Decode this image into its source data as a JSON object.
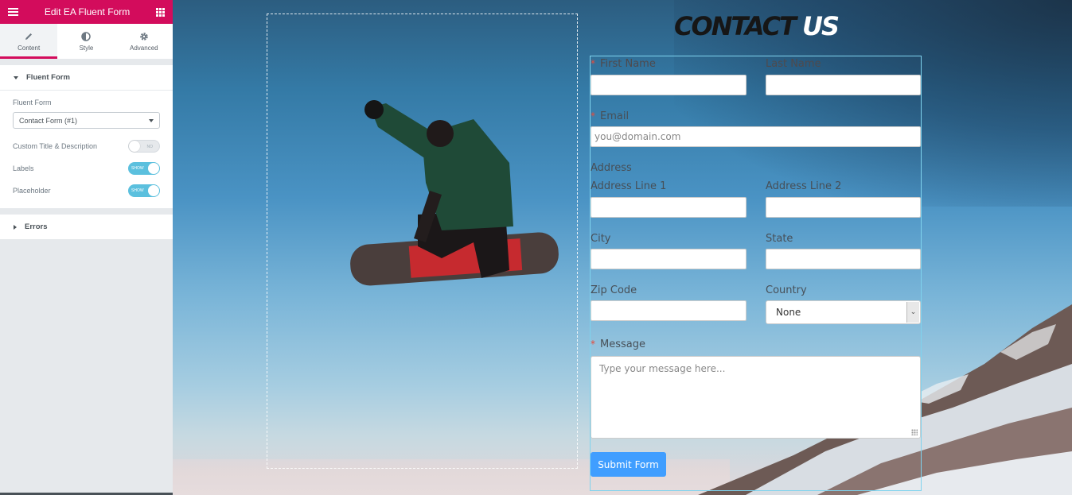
{
  "sidebar": {
    "header_title": "Edit EA Fluent Form",
    "menu_icon": "hamburger-icon",
    "apps_icon": "grid-icon",
    "tabs": [
      {
        "label": "Content",
        "icon": "pencil-icon",
        "active": true
      },
      {
        "label": "Style",
        "icon": "half-circle-icon",
        "active": false
      },
      {
        "label": "Advanced",
        "icon": "gear-icon",
        "active": false
      }
    ],
    "sections": {
      "fluent_form": {
        "title": "Fluent Form",
        "expanded": true,
        "form_select_label": "Fluent Form",
        "form_select_value": "Contact Form (#1)",
        "custom_title_label": "Custom Title & Description",
        "custom_title_toggle": "NO",
        "labels_label": "Labels",
        "labels_toggle": "SHOW",
        "placeholder_label": "Placeholder",
        "placeholder_toggle": "SHOW"
      },
      "errors": {
        "title": "Errors",
        "expanded": false
      }
    },
    "collapse_icon": "‹"
  },
  "canvas": {
    "heading": {
      "part1": "CONTACT",
      "part2": "US"
    },
    "form": {
      "first_name_label": "First Name",
      "last_name_label": "Last Name",
      "email_label": "Email",
      "email_placeholder": "you@domain.com",
      "address_label": "Address",
      "address_line1_label": "Address Line 1",
      "address_line2_label": "Address Line 2",
      "city_label": "City",
      "state_label": "State",
      "zip_label": "Zip Code",
      "country_label": "Country",
      "country_value": "None",
      "message_label": "Message",
      "message_placeholder": "Type your message here...",
      "submit_label": "Submit Form",
      "required_mark": "*"
    }
  },
  "colors": {
    "brand": "#d30c5c",
    "toggle_on": "#5bc0de",
    "submit": "#409eff",
    "form_outline": "#7fd3ee"
  }
}
